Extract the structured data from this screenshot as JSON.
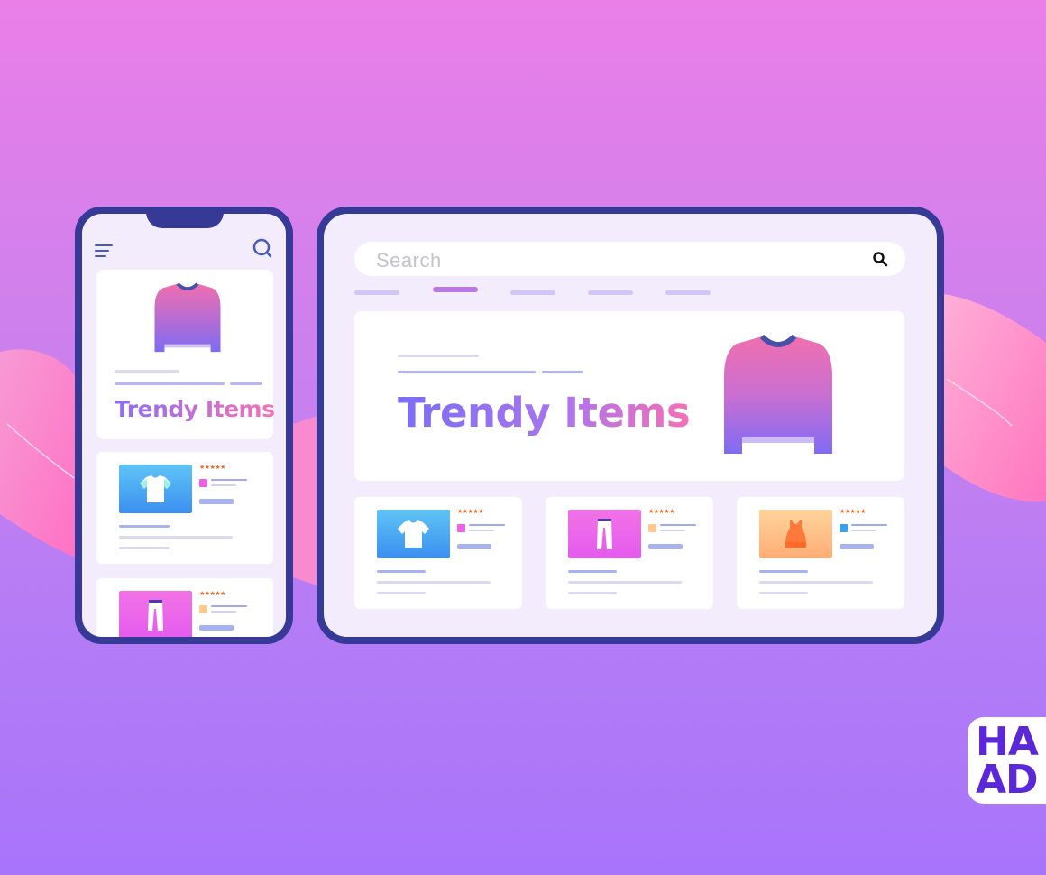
{
  "colors": {
    "frame": "#363a96",
    "screen": "#f2ecfd",
    "accent_tab": "#b77ae4",
    "star": "#ee6a2a"
  },
  "icons": {
    "menu": "hamburger-menu-icon",
    "phone_search": "search-icon",
    "tablet_search": "search-icon"
  },
  "phone": {
    "hero_title_1": "Trendy",
    "hero_title_2": "Items",
    "products": [
      {
        "stars": "★★★★★",
        "icon": "tshirt-icon"
      },
      {
        "stars": "★★★★★",
        "icon": "pants-icon"
      }
    ]
  },
  "tablet": {
    "search": {
      "placeholder": "Search"
    },
    "hero_title_1": "Trendy",
    "hero_title_2": "Items",
    "products": [
      {
        "stars": "★★★★★",
        "icon": "tshirt-icon"
      },
      {
        "stars": "★★★★★",
        "icon": "pants-icon"
      },
      {
        "stars": "★★★★★",
        "icon": "tank-top-icon"
      }
    ]
  },
  "logo": {
    "line1": "HA",
    "line2": "AD"
  }
}
